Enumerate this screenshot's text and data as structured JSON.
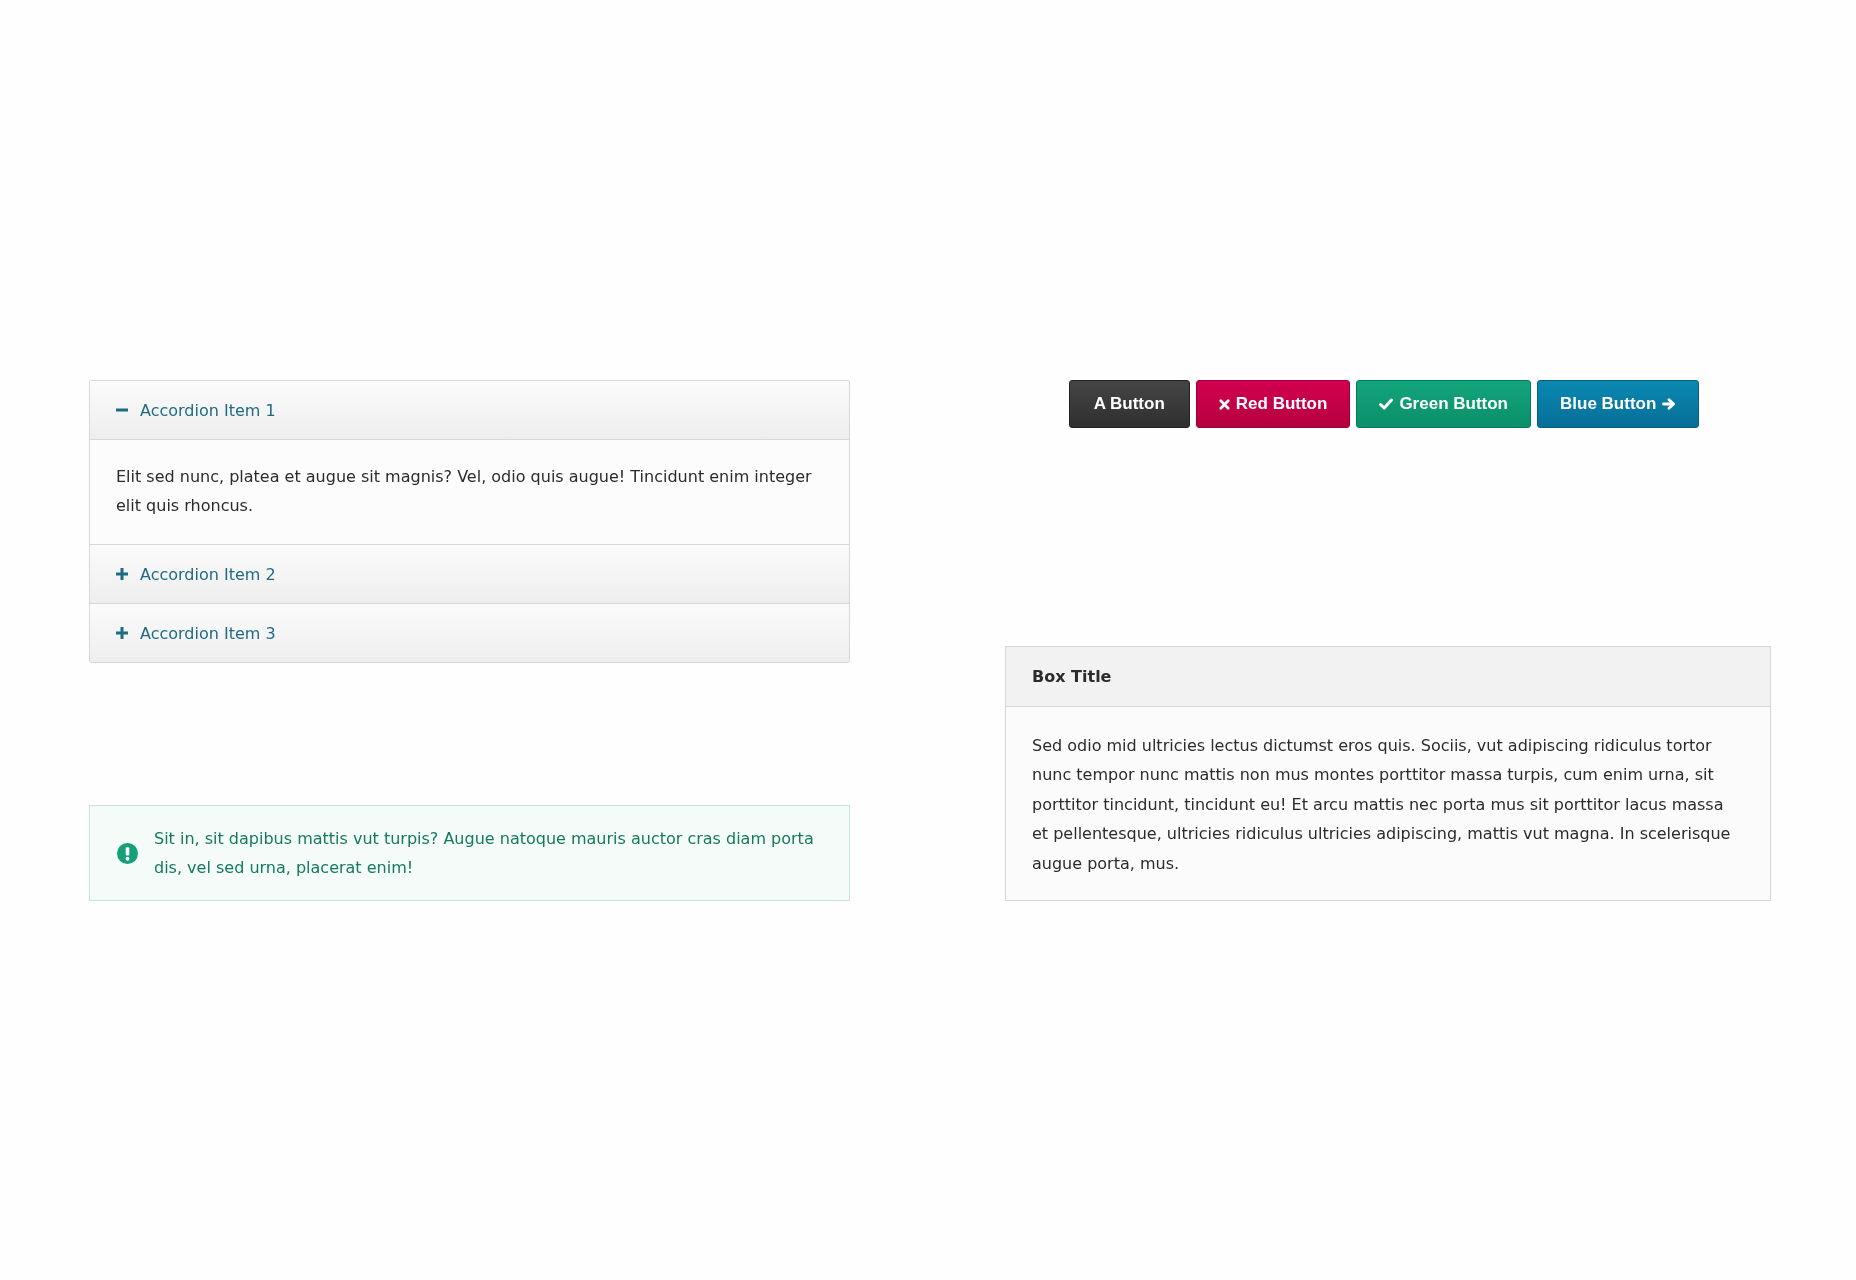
{
  "accordion": {
    "items": [
      {
        "title": "Accordion Item 1",
        "expanded": true,
        "content": "Elit sed nunc, platea et augue sit magnis? Vel, odio quis augue! Tincidunt enim integer elit quis rhoncus."
      },
      {
        "title": "Accordion Item 2",
        "expanded": false
      },
      {
        "title": "Accordion Item 3",
        "expanded": false
      }
    ]
  },
  "alert": {
    "text": "Sit in, sit dapibus mattis vut turpis? Augue natoque mauris auctor cras diam porta dis, vel sed urna, placerat enim!"
  },
  "buttons": [
    {
      "label": "A Button",
      "kind": "default"
    },
    {
      "label": "Red Button",
      "kind": "danger"
    },
    {
      "label": "Green Button",
      "kind": "success"
    },
    {
      "label": "Blue Button",
      "kind": "next"
    }
  ],
  "box": {
    "title": "Box Title",
    "text": "Sed odio mid ultricies lectus dictumst eros quis. Sociis, vut adipiscing ridiculus tortor nunc tempor nunc mattis non mus montes porttitor massa turpis, cum enim urna, sit porttitor tincidunt, tincidunt eu! Et arcu mattis nec porta mus sit porttitor lacus massa et pellentesque, ultricies ridiculus ultricies adipiscing, mattis vut magna. In scelerisque augue porta, mus."
  }
}
